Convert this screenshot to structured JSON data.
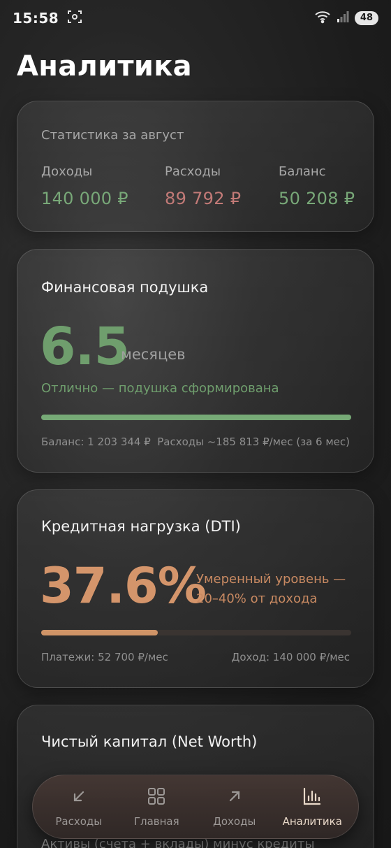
{
  "status_bar": {
    "time": "15:58",
    "battery": "48",
    "icons": [
      "screenshot-icon",
      "wifi-icon",
      "signal-icon",
      "battery-icon"
    ]
  },
  "page_title": "Аналитика",
  "stats": {
    "period": "Статистика за август",
    "income_label": "Доходы",
    "income_value": "140 000 ₽",
    "expense_label": "Расходы",
    "expense_value": "89 792 ₽",
    "balance_label": "Баланс",
    "balance_value": "50 208 ₽"
  },
  "cushion": {
    "title": "Финансовая подушка",
    "value": "6.5",
    "unit": "месяцев",
    "status": "Отлично — подушка сформирована",
    "progress": 1.0,
    "balance_text": "Баланс: 1 203 344 ₽",
    "expenses_text": "Расходы ~185 813 ₽/мес (за 6 мес)"
  },
  "dti": {
    "title": "Кредитная нагрузка (DTI)",
    "value": "37.6%",
    "desc": "Умеренный уровень — 20–40% от дохода",
    "progress": 0.376,
    "payments_text": "Платежи: 52 700 ₽/мес",
    "income_text": "Доход: 140 000 ₽/мес"
  },
  "net_worth": {
    "title": "Чистый капитал (Net Worth)",
    "subtitle": "Активы (счета + вклады) минус кредиты"
  },
  "nav": {
    "items": [
      {
        "label": "Расходы",
        "icon": "arrow-down-left-icon"
      },
      {
        "label": "Главная",
        "icon": "grid-icon"
      },
      {
        "label": "Доходы",
        "icon": "arrow-up-right-icon"
      },
      {
        "label": "Аналитика",
        "icon": "bar-chart-icon"
      }
    ],
    "active": "Аналитика"
  },
  "colors": {
    "green": "#78a878",
    "red": "#c27a77",
    "orange": "#d08f66"
  }
}
